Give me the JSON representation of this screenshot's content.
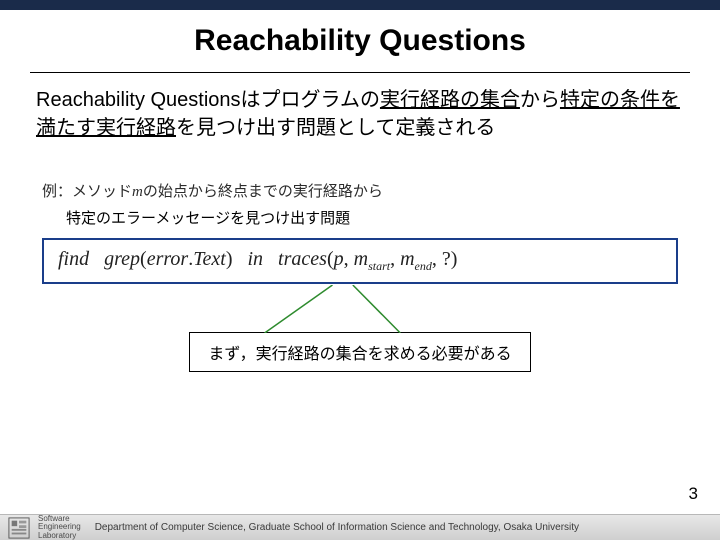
{
  "title": "Reachability Questions",
  "description": {
    "part1": "Reachability Questionsはプログラムの",
    "underline1": "実行経路の集合",
    "part2": "から",
    "underline2": "特定の条件を満たす実行経路",
    "part3": "を見つけ出す問題として定義される"
  },
  "example": {
    "label_prefix": "例：メソッド",
    "label_var": "m",
    "label_suffix": "の始点から終点までの実行経路から",
    "subline": "特定のエラーメッセージを見つけ出す問題"
  },
  "formula": {
    "find": "find",
    "grep": "grep",
    "lparen1": "(",
    "arg1a": "error",
    "dot1": ".",
    "arg1b": "Text",
    "rparen1": ")",
    "in": "in",
    "traces": "traces",
    "lparen2": "(",
    "p": "p",
    "comma1": ", ",
    "m1": "m",
    "sub1": "start",
    "comma2": ", ",
    "m2": "m",
    "sub2": "end",
    "comma3": ", ",
    "q": "?",
    "rparen2": ")"
  },
  "callout": "まず，実行経路の集合を求める必要がある",
  "page_number": "3",
  "footer": {
    "lab_line1": "Software",
    "lab_line2": "Engineering",
    "lab_line3": "Laboratory",
    "dept": "Department of Computer Science, Graduate School of Information Science and Technology, Osaka University"
  }
}
